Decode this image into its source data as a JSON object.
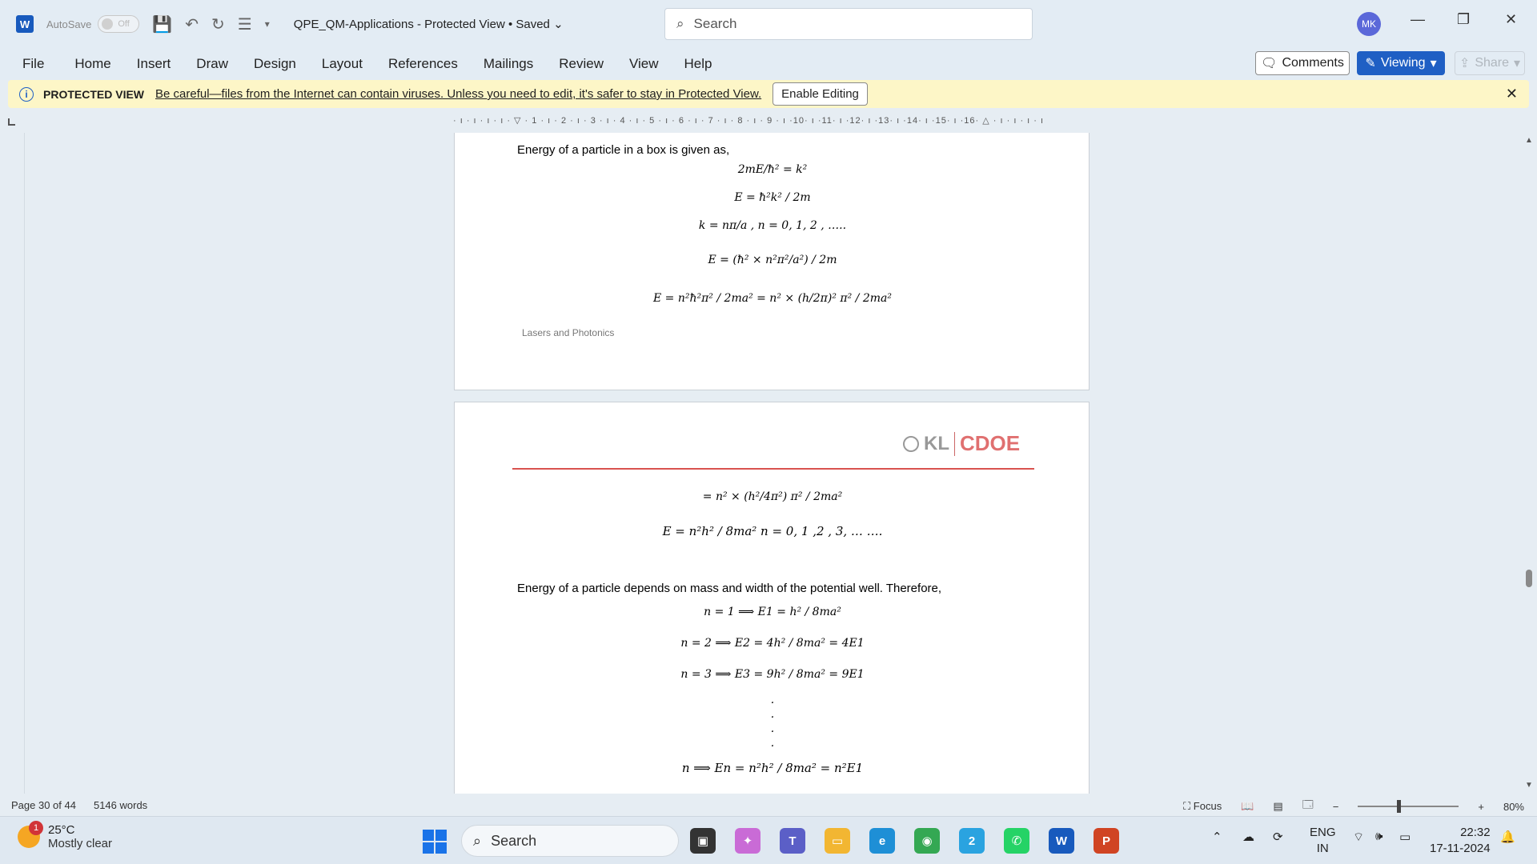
{
  "titlebar": {
    "app_icon": "W",
    "autosave_label": "AutoSave",
    "autosave_state": "Off",
    "doc_title": "QPE_QM-Applications  -  Protected View • Saved ⌄",
    "search_placeholder": "Search",
    "avatar_initials": "MK"
  },
  "ribbon": {
    "tabs": [
      "File",
      "Home",
      "Insert",
      "Draw",
      "Design",
      "Layout",
      "References",
      "Mailings",
      "Review",
      "View",
      "Help"
    ],
    "comments_label": "Comments",
    "viewing_label": "Viewing",
    "share_label": "Share"
  },
  "protected_view": {
    "title": "PROTECTED VIEW",
    "message": "Be careful—files from the Internet can contain viruses. Unless you need to edit, it's safer to stay in Protected View.",
    "enable_label": "Enable Editing"
  },
  "ruler": {
    "text": "· ı · ı · ı · ı · ▽ · 1 · ı · 2 · ı · 3 · ı · 4 · ı · 5 · ı · 6 · ı · 7 · ı · 8 · ı · 9 · ı ·10· ı ·11· ı ·12· ı ·13· ı ·14· ı ·15· ı ·16· △ · ı · ı · ı · ı"
  },
  "page1": {
    "intro": "Energy of a particle in a box is given as,",
    "eq1": "2mE/ħ² = k²",
    "eq2": "E = ħ²k² / 2m",
    "eq3": "k = nπ/a , n = 0, 1, 2 , ….. ",
    "eq4": "E = (ħ² × n²π²/a²) / 2m",
    "eq5": "E = n²ħ²π² / 2ma²  =  n² × (h/2π)² π² / 2ma²",
    "footer": "Lasers and Photonics"
  },
  "page2": {
    "logo_kl": "KL",
    "logo_cdoe": "CDOE",
    "eq6": "=  n² × (h²/4π²) π² / 2ma²",
    "eq7": "E  =  n²h² / 8ma²      n  =  0, 1 ,2 , 3, … ….",
    "text2": "Energy of a particle depends on mass and width of the potential well. Therefore,",
    "eq8": "n = 1 ⟹   E1 = h² / 8ma²",
    "eq9": "n = 2 ⟹   E2 = 4h² / 8ma²  =  4E1",
    "eq10": "n = 3 ⟹   E3 = 9h² / 8ma²  =  9E1",
    "dots": "·",
    "eq11": "n    ⟹ En  =  n²h² / 8ma²   =   n²E1"
  },
  "statusbar": {
    "page": "Page 30 of 44",
    "words": "5146 words",
    "focus": "Focus",
    "zoom_minus": "−",
    "zoom_plus": "+",
    "zoom": "80%",
    "zoom_fraction": 0.4
  },
  "taskbar": {
    "weather_badge": "1",
    "temp": "25°C",
    "condition": "Mostly clear",
    "search_label": "Search",
    "telegram_badge": "2",
    "lang_top": "ENG",
    "lang_bottom": "IN",
    "time": "22:32",
    "date": "17-11-2024"
  },
  "colors": {
    "word_blue": "#185abd",
    "viewing_blue": "#1f5fc4",
    "pv_yellow": "#fdf6c7",
    "kl_red": "#d9534f"
  }
}
